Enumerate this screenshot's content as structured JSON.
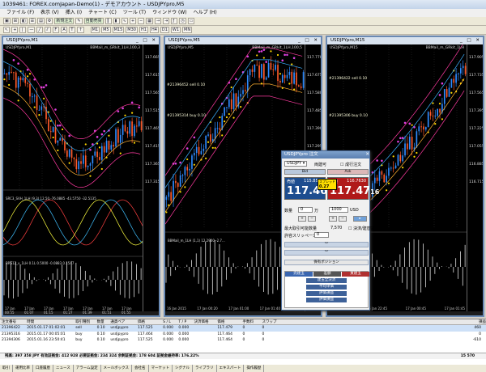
{
  "app": {
    "title": "1039461: FOREX.comJapan-Demo(1) - デモアカウント - USDJPYpro,M5"
  },
  "menu": [
    "ファイル (F)",
    "表示 (V)",
    "挿入 (I)",
    "チャート (C)",
    "ツール (T)",
    "ウィンドウ (W)",
    "ヘルプ (H)"
  ],
  "toolbar": {
    "new_order": "新規注文",
    "auto_trade": "自動売買",
    "timeframes": [
      "M1",
      "M5",
      "M15",
      "M30",
      "H1",
      "H4",
      "D1",
      "W1",
      "MN"
    ]
  },
  "charts": [
    {
      "title": "USDJPYpro,M1",
      "symbol": "USDJPYpro,M1",
      "indicator": "BBMail_m_GRkit_1LH,100,3",
      "price_labels": [
        "117.665",
        "117.615",
        "117.565",
        "117.515",
        "117.465",
        "117.415",
        "117.365",
        "117.315"
      ],
      "sub1": "SRC3_SVH_1LH (9,3) 12,50,-76.0885 -43.5750 -32.5135",
      "sub2": "BRS12_v_1LH 0.1L 0.5000 -0.0883 0.1547",
      "times": [
        "17 Jan 00:55",
        "17 Jan 01:07",
        "17 Jan 01:15",
        "17 Jan 01:27",
        "17 Jan 01:39",
        "17 Jan 01:51",
        "17 Jan 01:55"
      ]
    },
    {
      "title": "USDJPYpro,M5",
      "symbol": "USDJPYpro,M5",
      "indicator": "BBMail_m_GRkit_1LH,100,5",
      "price_labels": [
        "117.770",
        "117.675",
        "117.580",
        "117.485",
        "117.390",
        "117.295",
        "117.200",
        "117.105"
      ],
      "annot": [
        "#21396452 sell 0.10",
        "#21395314 buy 0.10"
      ],
      "sub1": "BBMail_m_1LH (1,1) 12.2900 -2.7...",
      "sub2": "",
      "times": [
        "16 Jan 2015",
        "17 Jan 00:20",
        "17 Jan 01:00",
        "17 Jan 01:40"
      ]
    },
    {
      "title": "USDJPYpro,M15",
      "symbol": "USDJPYpro,M15",
      "indicator": "BBMail_m_GRkit_1LH",
      "price_labels": [
        "117.905",
        "117.735",
        "117.565",
        "117.395",
        "117.225",
        "117.055",
        "116.885",
        "116.715"
      ],
      "annot": [
        "#21396422 sell 0.10",
        "#21395306 buy 0.10"
      ],
      "sub1": "",
      "sub2": "",
      "times": [
        "16 Jan 2015",
        "16 Jan 22:45",
        "17 Jan 00:45",
        "17 Jan 01:45"
      ]
    }
  ],
  "order_dialog": {
    "title": "USDJPYpro 注文",
    "symbol": "USDJPY",
    "mode_label": "両建可",
    "checkbox_label": "成行注文",
    "bid": {
      "label": "売値",
      "sub": "115.8527",
      "big": "117.46",
      "small": "89"
    },
    "ask": {
      "label": "買値",
      "sub": "116.7630",
      "big": "117.47",
      "small": "16"
    },
    "spread_label": "スプレッド",
    "spread": "0.27",
    "quantity_label": "数量",
    "quantity": "0",
    "unit": "万",
    "amount": "1000",
    "currency": "USD",
    "max_label": "最大取引可能数量",
    "max_value": "7,570",
    "slippage_label": "許容スリッページ",
    "slippage": "0",
    "position_label": "保有ポジション",
    "settle_label": "決済/建替設定",
    "sell_header": "売建玉",
    "buy_header": "買建玉",
    "net_header": "差額",
    "rows": [
      "建玉全決済",
      "平均単価",
      "評価損益",
      "評価損益"
    ]
  },
  "terminal": {
    "columns": [
      "注文番号",
      "時間",
      "取引種別",
      "数量",
      "通貨ペア",
      "価格",
      "S / L",
      "T / P",
      "決済価格",
      "価格",
      "手数料",
      "スワップ",
      "損益"
    ],
    "rows": [
      [
        "21396422",
        "2015.01.17 01:02:01",
        "sell",
        "0.10",
        "usdjpypro",
        "117.525",
        "0.000",
        "0.000",
        "",
        "117.479",
        "0",
        "0",
        "460"
      ],
      [
        "21395316",
        "2015.01.17 00:05:01",
        "buy",
        "0.10",
        "usdjpypro",
        "117.464",
        "0.000",
        "0.000",
        "",
        "117.464",
        "0",
        "0",
        "0"
      ],
      [
        "21394306",
        "2015.01.16 23:50:41",
        "buy",
        "0.10",
        "usdjpypro",
        "117.525",
        "0.000",
        "0.000",
        "",
        "117.464",
        "0",
        "0",
        "-610"
      ]
    ],
    "summary": "残高: 397 358 JPY  有効証拠金: 412 928  必要証拠金: 234 324  余剰証拠金: 178 604  証拠金維持率: 176.22%",
    "total": "15 570"
  },
  "tabs": [
    "取引",
    "運用比率",
    "口座履歴",
    "ニュース",
    "アラーム設定",
    "メールボックス",
    "会社名",
    "マーケット",
    "シグナル",
    "ライブラリ",
    "エキスパート",
    "操作履歴"
  ]
}
